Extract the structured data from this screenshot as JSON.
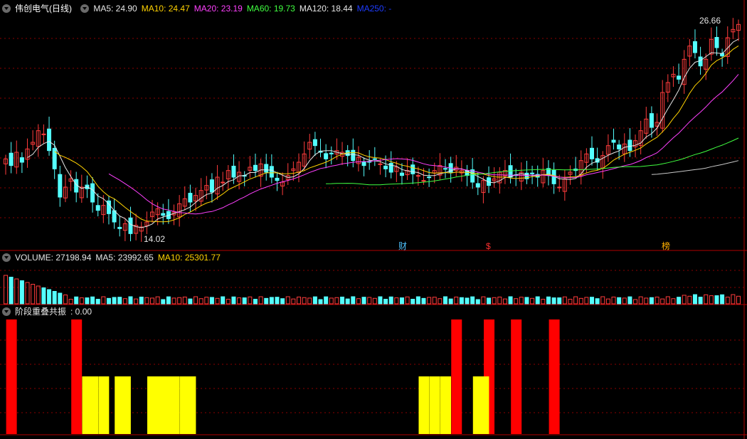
{
  "price_panel": {
    "title": "伟创电气(日线)",
    "indicators": [
      {
        "label": "MA5: 24.90",
        "color": "#e6e6e6"
      },
      {
        "label": "MA10: 24.47",
        "color": "#ffd200"
      },
      {
        "label": "MA20: 23.19",
        "color": "#ff40ff"
      },
      {
        "label": "MA60: 19.73",
        "color": "#40ff40"
      },
      {
        "label": "MA120: 18.44",
        "color": "#e6e6e6"
      },
      {
        "label": "MA250: -",
        "color": "#1e3cff"
      }
    ],
    "high_label": "26.66",
    "low_label": "14.02",
    "event_tags": [
      {
        "text": "财",
        "color": "#4fc3ff"
      },
      {
        "text": "$",
        "color": "#ff3030"
      },
      {
        "text": "榜",
        "color": "#ffb000"
      }
    ]
  },
  "volume_panel": {
    "label": "VOLUME: 27198.94",
    "ma5": "MA5: 23992.65",
    "ma10": "MA10: 25301.77"
  },
  "signal_panel": {
    "label": "阶段重叠共振",
    "value": ": 0.00"
  },
  "colors": {
    "up": "#ff3c3c",
    "down": "#54ffff",
    "grid": "#8b0000",
    "signal_red": "#ff0000",
    "signal_yellow": "#ffff00"
  },
  "chart_data": {
    "type": "candlestick",
    "series_closes": [
      18.6,
      18.2,
      19.0,
      18.4,
      19.2,
      19.6,
      20.3,
      20.1,
      19.1,
      18.0,
      16.3,
      16.9,
      17.4,
      16.6,
      16.9,
      16.8,
      16.0,
      15.5,
      15.8,
      15.3,
      14.8,
      14.4,
      14.7,
      14.1,
      14.6,
      14.5,
      14.8,
      15.4,
      15.6,
      15.2,
      15.0,
      15.4,
      15.9,
      16.2,
      16.0,
      16.4,
      16.7,
      17.0,
      16.6,
      17.5,
      17.2,
      17.9,
      17.5,
      17.8,
      17.6,
      18.1,
      17.9,
      18.3,
      17.8,
      17.5,
      17.3,
      17.2,
      17.6,
      18.0,
      18.4,
      18.9,
      19.6,
      19.4,
      19.0,
      18.6,
      18.9,
      19.1,
      19.0,
      18.8,
      18.5,
      18.7,
      18.2,
      18.4,
      18.6,
      18.3,
      18.0,
      17.8,
      18.1,
      17.6,
      17.9,
      17.7,
      17.6,
      17.3,
      17.5,
      17.9,
      18.2,
      18.0,
      17.8,
      18.1,
      17.9,
      17.6,
      17.2,
      16.9,
      17.3,
      17.0,
      17.4,
      17.8,
      17.9,
      17.5,
      17.6,
      17.8,
      17.4,
      17.7,
      17.5,
      17.9,
      17.6,
      17.1,
      16.9,
      17.4,
      17.8,
      17.9,
      18.5,
      18.9,
      18.6,
      18.4,
      18.8,
      19.4,
      19.6,
      19.2,
      19.5,
      19.1,
      19.7,
      20.3,
      21.0,
      20.5,
      20.8,
      22.6,
      23.2,
      23.7,
      23.4,
      24.6,
      25.4,
      25.0,
      24.2,
      24.6,
      25.8,
      25.3,
      24.8,
      25.9,
      26.4,
      26.7
    ],
    "high": 26.66,
    "low": 14.02,
    "ma5": 24.9,
    "ma10": 24.47,
    "ma20": 23.19,
    "ma60": 19.73,
    "ma120": 18.44,
    "volume": 27198.94,
    "volume_ma5": 23992.65,
    "volume_ma10": 25301.77,
    "signal_red_bars": [
      1,
      13,
      83,
      89,
      94,
      101
    ],
    "signal_yellow_bars": [
      [
        15,
        16
      ],
      [
        18,
        18
      ],
      [
        21,
        22
      ],
      [
        27,
        31
      ],
      [
        33,
        34
      ],
      [
        77,
        77
      ],
      [
        79,
        79
      ],
      [
        81,
        81
      ],
      [
        87,
        88
      ]
    ]
  }
}
